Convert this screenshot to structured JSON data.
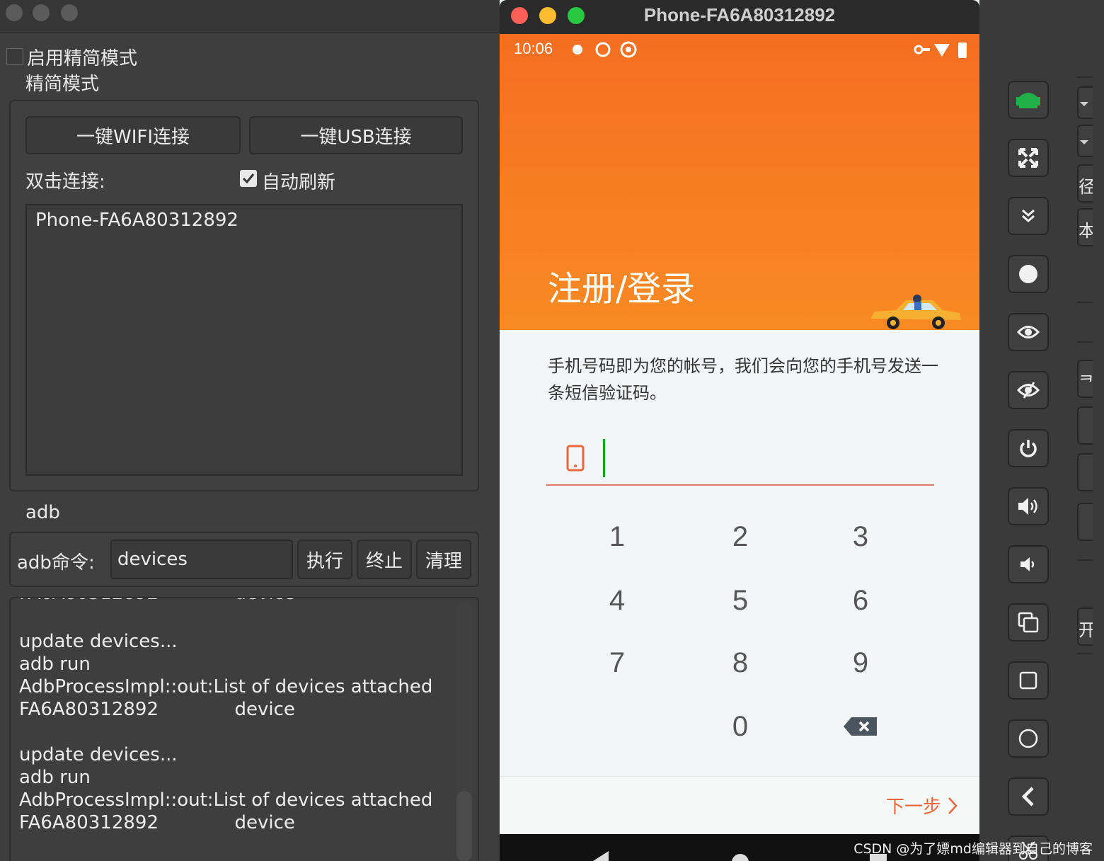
{
  "left_panel": {
    "simple_mode_checkbox_label": "启用精简模式",
    "simple_mode_label": "精简模式",
    "wifi_button": "一键WIFI连接",
    "usb_button": "一键USB连接",
    "double_click_label": "双击连接:",
    "auto_refresh_label": "自动刷新",
    "auto_refresh_checked": true,
    "devices": [
      "Phone-FA6A80312892"
    ],
    "adb_section_label": "adb",
    "adb_command_label": "adb命令:",
    "adb_command_value": "devices",
    "execute_button": "执行",
    "stop_button": "终止",
    "clear_button": "清理",
    "log_lines": [
      "update devices...",
      "adb run",
      "AdbProcessImpl::out:List of devices attached",
      "FA6A80312892             device",
      "",
      "update devices...",
      "adb run",
      "AdbProcessImpl::out:List of devices attached",
      "FA6A80312892             device"
    ]
  },
  "phone_window": {
    "title": "Phone-FA6A80312892",
    "status_time": "10:06",
    "hero_title": "注册/登录",
    "description": "手机号码即为您的帐号，我们会向您的手机号发送一条短信验证码。",
    "keypad": [
      "1",
      "2",
      "3",
      "4",
      "5",
      "6",
      "7",
      "8",
      "9",
      "0"
    ],
    "next_button": "下一步",
    "colors": {
      "hero_orange": "#f56e22",
      "accent": "#e8673d",
      "caret": "#11a611"
    }
  },
  "side_strip": {
    "buttons": [
      "android-icon",
      "fullscreen-icon",
      "collapse-icon",
      "record-icon",
      "eye-icon",
      "eye-off-icon",
      "power-icon",
      "volume-up-icon",
      "volume-down-icon",
      "copy-icon",
      "square-icon",
      "circle-icon",
      "back-icon"
    ],
    "edge_tabs": [
      "径",
      "本",
      "ᄏ",
      "开"
    ]
  },
  "watermark": "CSDN @为了嫖md编辑器到自己的博客"
}
